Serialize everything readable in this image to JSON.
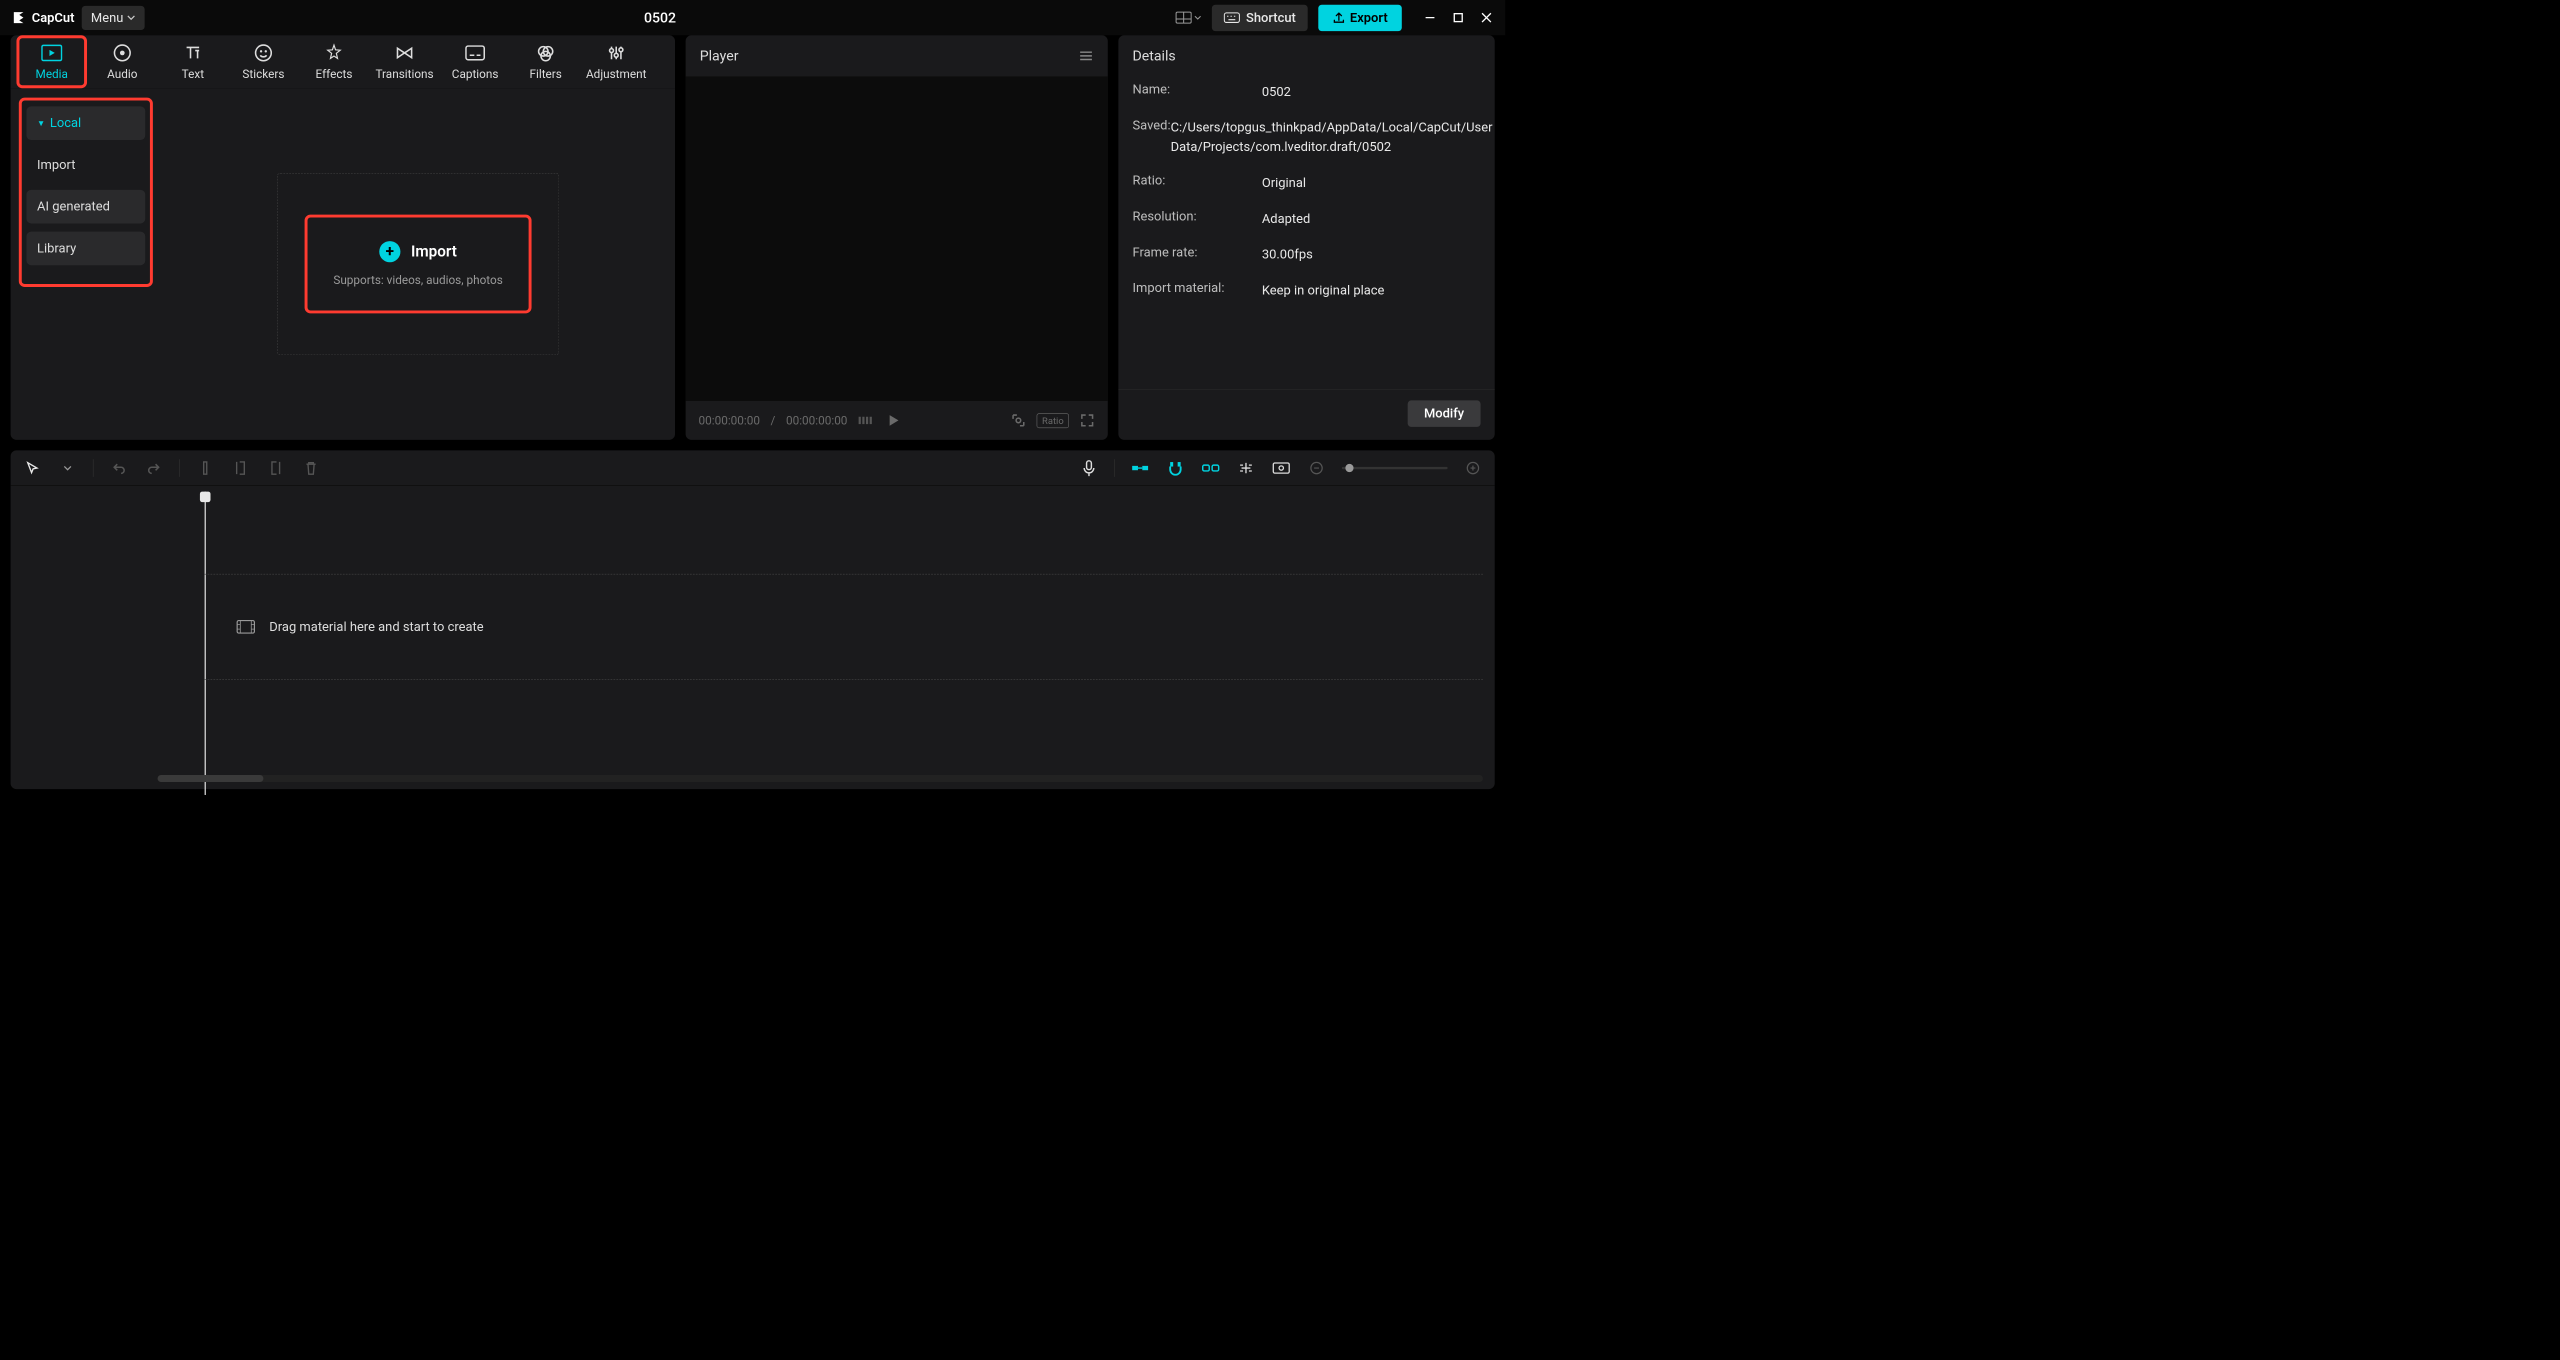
{
  "titlebar": {
    "brand": "CapCut",
    "menu_label": "Menu",
    "project_title": "0502",
    "shortcut_label": "Shortcut",
    "export_label": "Export"
  },
  "tabs": [
    {
      "label": "Media",
      "icon": "media-icon",
      "active": true
    },
    {
      "label": "Audio",
      "icon": "audio-icon"
    },
    {
      "label": "Text",
      "icon": "text-icon"
    },
    {
      "label": "Stickers",
      "icon": "stickers-icon"
    },
    {
      "label": "Effects",
      "icon": "effects-icon"
    },
    {
      "label": "Transitions",
      "icon": "transitions-icon"
    },
    {
      "label": "Captions",
      "icon": "captions-icon"
    },
    {
      "label": "Filters",
      "icon": "filters-icon"
    },
    {
      "label": "Adjustment",
      "icon": "adjustment-icon"
    }
  ],
  "sidebar": {
    "items": [
      {
        "label": "Local",
        "active": true
      },
      {
        "label": "Import"
      },
      {
        "label": "AI generated"
      },
      {
        "label": "Library"
      }
    ]
  },
  "import_box": {
    "title": "Import",
    "subtitle": "Supports: videos, audios, photos"
  },
  "player": {
    "header": "Player",
    "time_current": "00:00:00:00",
    "time_sep": "/",
    "time_total": "00:00:00:00",
    "ratio_label": "Ratio"
  },
  "details": {
    "header": "Details",
    "rows": [
      {
        "label": "Name:",
        "value": "0502"
      },
      {
        "label": "Saved:",
        "value": "C:/Users/topgus_thinkpad/AppData/Local/CapCut/User Data/Projects/com.lveditor.draft/0502"
      },
      {
        "label": "Ratio:",
        "value": "Original"
      },
      {
        "label": "Resolution:",
        "value": "Adapted"
      },
      {
        "label": "Frame rate:",
        "value": "30.00fps"
      },
      {
        "label": "Import material:",
        "value": "Keep in original place"
      }
    ],
    "modify_label": "Modify"
  },
  "timeline": {
    "placeholder": "Drag material here and start to create"
  }
}
